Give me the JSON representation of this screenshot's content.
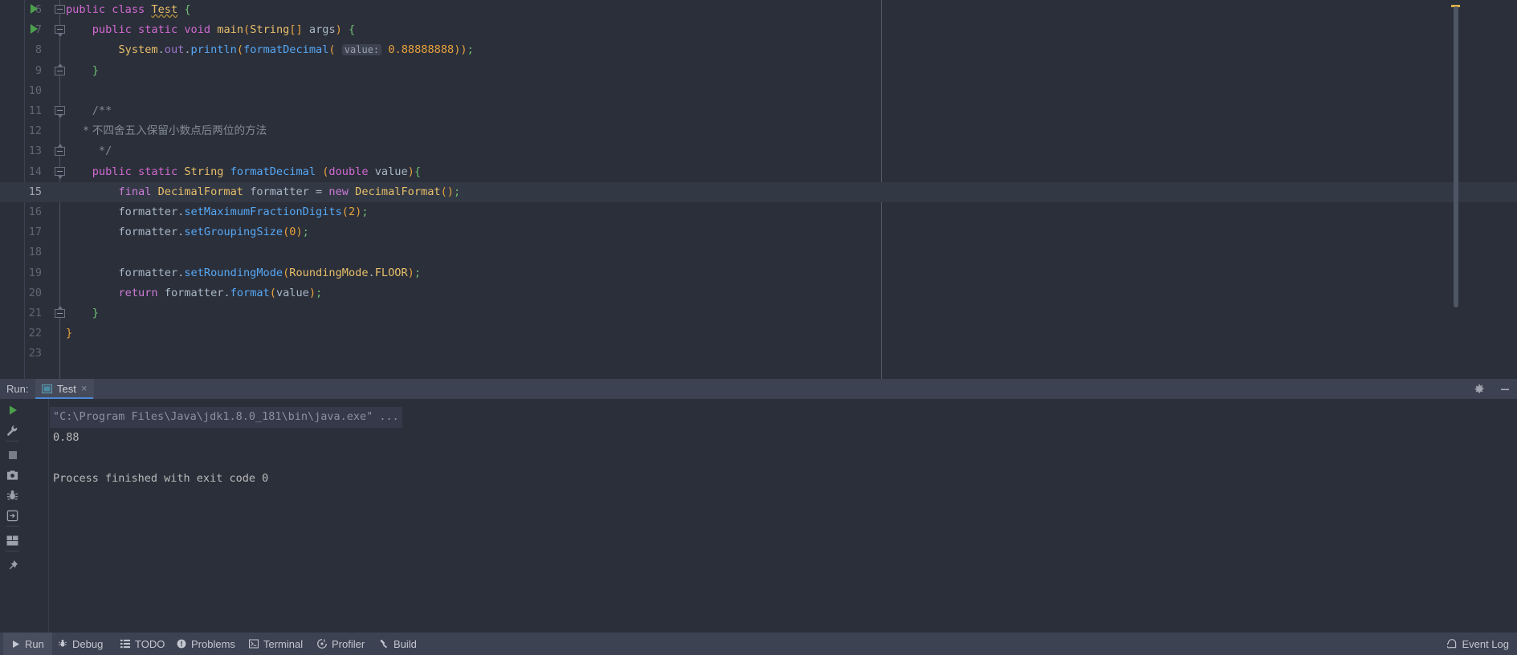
{
  "editor": {
    "first_line": 6,
    "last_line": 23,
    "caret_line": 15,
    "right_margin_column_guide": true,
    "lines": [
      {
        "n": 6,
        "run_arrow": true,
        "fold": "start",
        "indent": 0
      },
      {
        "n": 7,
        "run_arrow": true,
        "fold": "start",
        "indent": 0
      },
      {
        "n": 8,
        "run_arrow": false,
        "fold": "",
        "indent": 0
      },
      {
        "n": 9,
        "run_arrow": false,
        "fold": "end",
        "indent": 0
      },
      {
        "n": 10,
        "run_arrow": false,
        "fold": "",
        "indent": 0
      },
      {
        "n": 11,
        "run_arrow": false,
        "fold": "start",
        "indent": 0
      },
      {
        "n": 12,
        "run_arrow": false,
        "fold": "",
        "indent": 0
      },
      {
        "n": 13,
        "run_arrow": false,
        "fold": "end",
        "indent": 0
      },
      {
        "n": 14,
        "run_arrow": false,
        "fold": "start",
        "indent": 0
      },
      {
        "n": 15,
        "run_arrow": false,
        "fold": "",
        "indent": 0
      },
      {
        "n": 16,
        "run_arrow": false,
        "fold": "",
        "indent": 0
      },
      {
        "n": 17,
        "run_arrow": false,
        "fold": "",
        "indent": 0
      },
      {
        "n": 18,
        "run_arrow": false,
        "fold": "",
        "indent": 0
      },
      {
        "n": 19,
        "run_arrow": false,
        "fold": "",
        "indent": 0
      },
      {
        "n": 20,
        "run_arrow": false,
        "fold": "",
        "indent": 0
      },
      {
        "n": 21,
        "run_arrow": false,
        "fold": "end",
        "indent": 0
      },
      {
        "n": 22,
        "run_arrow": false,
        "fold": "",
        "indent": 0
      },
      {
        "n": 23,
        "run_arrow": false,
        "fold": "",
        "indent": 0
      }
    ],
    "source_text": [
      "public class Test {",
      "    public static void main(String[] args) {",
      "        System.out.println(formatDecimal( value: 0.88888888));",
      "    }",
      "",
      "    /**",
      "     * 不四舍五入保留小数点后两位的方法",
      "     */",
      "    public static String formatDecimal (double value){",
      "        final DecimalFormat formatter = new DecimalFormat();",
      "        formatter.setMaximumFractionDigits(2);",
      "        formatter.setGroupingSize(0);",
      "",
      "        formatter.setRoundingMode(RoundingMode.FLOOR);",
      "        return formatter.format(value);",
      "    }",
      "}",
      ""
    ],
    "tokens": {
      "class_name": "Test",
      "method_name": "formatDecimal",
      "param_hint": "value:",
      "literal_value": "0.88888888",
      "comment_line": "* 不四舍五入保留小数点后两位的方法",
      "comment_open": "/**",
      "comment_close": "*/",
      "variable": "formatter",
      "type_name": "DecimalFormat",
      "rounding_mode": "RoundingMode.FLOOR",
      "digits_arg": "2",
      "grouping_arg": "0"
    }
  },
  "run_panel": {
    "label": "Run:",
    "tab_name": "Test",
    "tab_close": "×",
    "header_icons": [
      {
        "name": "settings-gear-icon"
      },
      {
        "name": "minimize-icon"
      }
    ],
    "toolbar_primary": [
      {
        "name": "rerun-icon",
        "title": "Rerun"
      },
      {
        "name": "wrench-icon",
        "title": "Edit Configuration"
      },
      {
        "name": "stop-icon",
        "title": "Stop"
      },
      {
        "name": "camera-icon",
        "title": "Capture Memory Snapshot"
      },
      {
        "name": "debug-bug-icon",
        "title": "Attach Debugger"
      },
      {
        "name": "export-icon",
        "title": "Export"
      },
      {
        "name": "layout-icon",
        "title": "Layout Settings"
      },
      {
        "name": "pin-icon",
        "title": "Pin Tab"
      }
    ],
    "toolbar_secondary": [
      {
        "name": "highlight-pen-icon",
        "title": "Highlight"
      },
      {
        "name": "arrow-up-red-icon",
        "title": "Previous Error"
      },
      {
        "name": "arrow-down-red-icon",
        "title": "Next Error"
      },
      {
        "name": "soft-wrap-sort-icon",
        "title": "Soft-Wrap"
      },
      {
        "name": "arrow-up-icon",
        "title": "Up the Stack Trace"
      },
      {
        "name": "arrow-down-icon",
        "title": "Down the Stack Trace"
      },
      {
        "name": "wrap-text-icon",
        "title": "Use Soft Wraps"
      },
      {
        "name": "scroll-to-end-icon",
        "title": "Scroll to the End",
        "selected": true
      },
      {
        "name": "print-icon",
        "title": "Print"
      },
      {
        "name": "trash-icon",
        "title": "Clear All"
      }
    ],
    "console_lines": [
      {
        "text": "\"C:\\Program Files\\Java\\jdk1.8.0_181\\bin\\java.exe\" ...",
        "style": "command"
      },
      {
        "text": "0.88",
        "style": "output"
      },
      {
        "text": "",
        "style": "output"
      },
      {
        "text": "Process finished with exit code 0",
        "style": "output"
      }
    ]
  },
  "status_bar": {
    "items": [
      {
        "label": "Run",
        "icon": "play-icon",
        "active": true
      },
      {
        "label": "Debug",
        "icon": "bug-icon",
        "active": false
      },
      {
        "label": "TODO",
        "icon": "list-icon",
        "active": false
      },
      {
        "label": "Problems",
        "icon": "warning-circle-icon",
        "active": false
      },
      {
        "label": "Terminal",
        "icon": "terminal-icon",
        "active": false
      },
      {
        "label": "Profiler",
        "icon": "profiler-icon",
        "active": false
      },
      {
        "label": "Build",
        "icon": "hammer-icon",
        "active": false
      }
    ],
    "event_log": {
      "label": "Event Log",
      "icon": "bell-icon"
    }
  },
  "colors": {
    "editor_bg": "#2b2f3a",
    "panel_bg": "#3c4251",
    "caret_line": "#323844",
    "accent_blue": "#4a88d6",
    "keyword": "#cc7cd6",
    "string_yellow": "#e8bf6a",
    "method_blue": "#56a8f5",
    "number_orange": "#e8a33d",
    "comment_grey": "#808b94",
    "run_green": "#4ca04c"
  }
}
